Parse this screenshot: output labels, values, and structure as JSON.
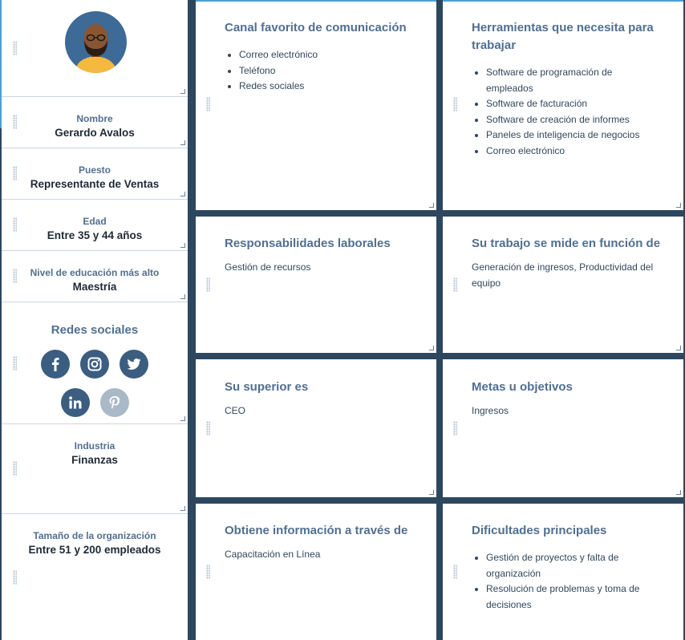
{
  "profile": {
    "avatar_icon": "persona-avatar-icon",
    "fields": [
      {
        "label": "Nombre",
        "value": "Gerardo Avalos"
      },
      {
        "label": "Puesto",
        "value": "Representante de Ventas"
      },
      {
        "label": "Edad",
        "value": "Entre 35 y 44 años"
      },
      {
        "label": "Nivel de educación más alto",
        "value": "Maestría"
      }
    ],
    "social": {
      "title": "Redes sociales",
      "icons": [
        "facebook-icon",
        "instagram-icon",
        "twitter-icon",
        "linkedin-icon",
        "pinterest-icon"
      ]
    },
    "industry": {
      "label": "Industria",
      "value": "Finanzas"
    },
    "org_size": {
      "label": "Tamaño de la organización",
      "value": "Entre 51 y 200 empleados"
    }
  },
  "cards": {
    "channel": {
      "title": "Canal favorito de comunicación",
      "items": [
        "Correo electrónico",
        "Teléfono",
        "Redes sociales"
      ]
    },
    "tools": {
      "title": "Herramientas que necesita para trabajar",
      "items": [
        "Software de programación de empleados",
        "Software de facturación",
        "Software de creación de informes",
        "Paneles de inteligencia de negocios",
        "Correo electrónico"
      ]
    },
    "responsibilities": {
      "title": "Responsabilidades laborales",
      "text": "Gestión de recursos"
    },
    "measured": {
      "title": "Su trabajo se mide en función de",
      "text": "Generación de ingresos, Productividad del equipo"
    },
    "superior": {
      "title": "Su superior es",
      "text": "CEO"
    },
    "goals": {
      "title": "Metas u objetivos",
      "text": "Ingresos"
    },
    "info": {
      "title": "Obtiene información a través de",
      "text": "Capacitación en Línea"
    },
    "challenges": {
      "title": "Dificultades principales",
      "items": [
        "Gestión de proyectos y falta de organización",
        "Resolución de problemas y toma de decisiones"
      ]
    }
  },
  "colors": {
    "accent": "#4a9fd6",
    "background": "#2d475f",
    "label": "#516f90"
  }
}
